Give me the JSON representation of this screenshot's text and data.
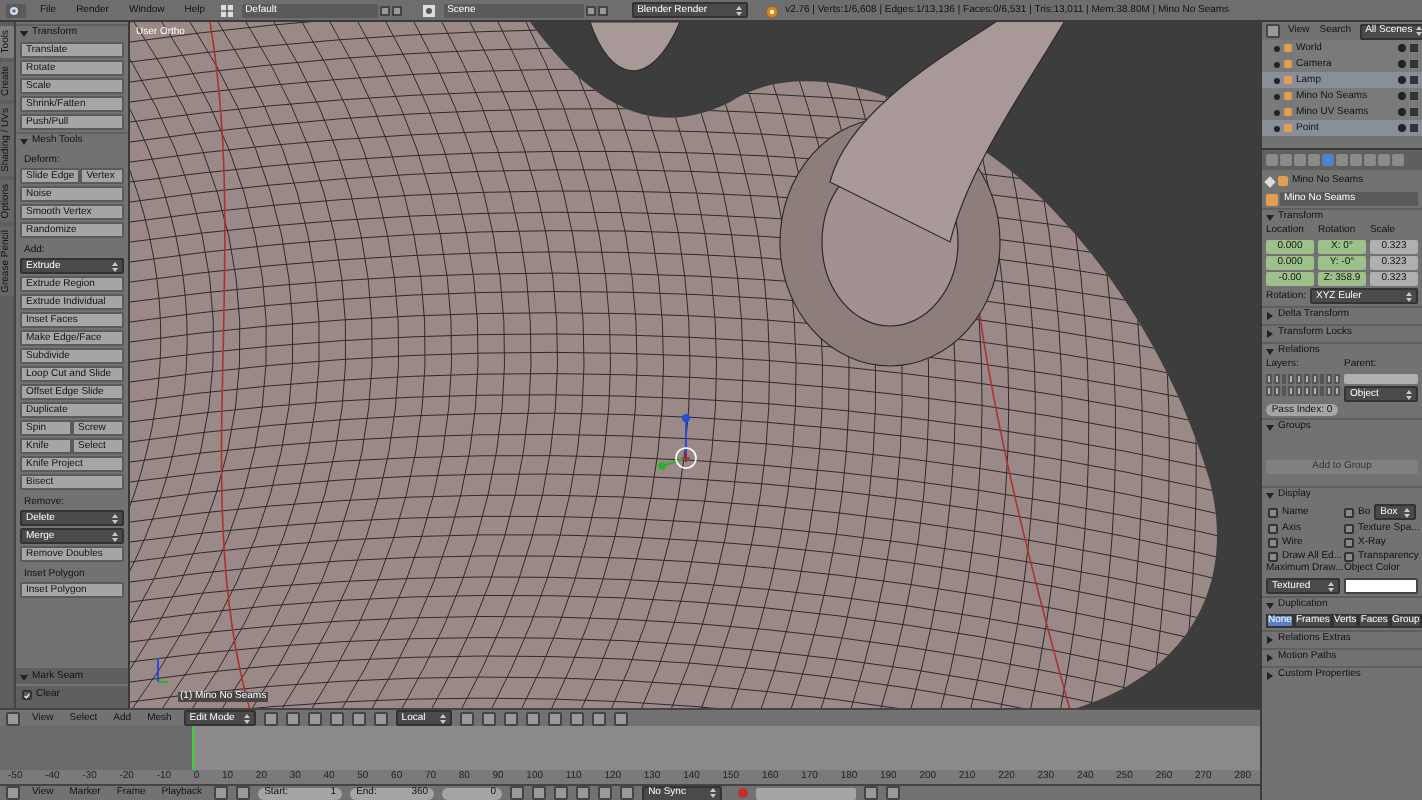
{
  "top_bar": {
    "menus": [
      "File",
      "Render",
      "Window",
      "Help"
    ],
    "layout": "Default",
    "scene": "Scene",
    "engine": "Blender Render",
    "stats": "v2.76 | Verts:1/6,608 | Edges:1/13,136 | Faces:0/6,531 | Tris:13,011 | Mem:38.80M | Mino No Seams"
  },
  "tool_shelf": {
    "tabs": [
      {
        "label": "Tools",
        "selected": true
      },
      {
        "label": "Create",
        "selected": false
      },
      {
        "label": "Shading / UVs",
        "selected": false
      },
      {
        "label": "Options",
        "selected": false
      },
      {
        "label": "Grease Pencil",
        "selected": false
      }
    ],
    "items": [
      {
        "kind": "header",
        "label": "Transform",
        "expanded": true
      },
      {
        "kind": "button",
        "label": "Translate"
      },
      {
        "kind": "button",
        "label": "Rotate"
      },
      {
        "kind": "button",
        "label": "Scale"
      },
      {
        "kind": "button",
        "label": "Shrink/Fatten"
      },
      {
        "kind": "button",
        "label": "Push/Pull"
      },
      {
        "kind": "header",
        "label": "Mesh Tools",
        "expanded": true
      },
      {
        "kind": "label",
        "label": "Deform:"
      },
      {
        "kind": "pair",
        "labels": [
          "Slide Edge",
          "Vertex"
        ]
      },
      {
        "kind": "button",
        "label": "Noise"
      },
      {
        "kind": "button",
        "label": "Smooth Vertex"
      },
      {
        "kind": "button",
        "label": "Randomize"
      },
      {
        "kind": "label",
        "label": "Add:"
      },
      {
        "kind": "dropdown",
        "label": "Extrude"
      },
      {
        "kind": "button",
        "label": "Extrude Region"
      },
      {
        "kind": "button",
        "label": "Extrude Individual"
      },
      {
        "kind": "button",
        "label": "Inset Faces"
      },
      {
        "kind": "button",
        "label": "Make Edge/Face"
      },
      {
        "kind": "button",
        "label": "Subdivide"
      },
      {
        "kind": "button",
        "label": "Loop Cut and Slide"
      },
      {
        "kind": "button",
        "label": "Offset Edge Slide"
      },
      {
        "kind": "button",
        "label": "Duplicate"
      },
      {
        "kind": "pair",
        "labels": [
          "Spin",
          "Screw"
        ]
      },
      {
        "kind": "pair",
        "labels": [
          "Knife",
          "Select"
        ]
      },
      {
        "kind": "button",
        "label": "Knife Project"
      },
      {
        "kind": "button",
        "label": "Bisect"
      },
      {
        "kind": "label",
        "label": "Remove:"
      },
      {
        "kind": "dropdown",
        "label": "Delete"
      },
      {
        "kind": "dropdown",
        "label": "Merge"
      },
      {
        "kind": "button",
        "label": "Remove Doubles"
      },
      {
        "kind": "label",
        "label": "Inset Polygon"
      },
      {
        "kind": "button",
        "label": "Inset Polygon"
      }
    ],
    "operator": {
      "title": "Mark Seam",
      "expanded": true,
      "options": [
        {
          "label": "Clear",
          "checked": true
        }
      ]
    }
  },
  "viewport": {
    "view_label": "User Ortho",
    "object_label": "(1) Mino No Seams"
  },
  "view3d_header": {
    "menus": [
      "View",
      "Select",
      "Add",
      "Mesh"
    ],
    "mode": "Edit Mode",
    "orientation": "Local"
  },
  "timeline": {
    "ruler": [
      "-50",
      "-40",
      "-30",
      "-20",
      "-10",
      "0",
      "10",
      "20",
      "30",
      "40",
      "50",
      "60",
      "70",
      "80",
      "90",
      "100",
      "110",
      "120",
      "130",
      "140",
      "150",
      "160",
      "170",
      "180",
      "190",
      "200",
      "210",
      "220",
      "230",
      "240",
      "250",
      "260",
      "270",
      "280"
    ],
    "playhead": {
      "level": 0.152
    }
  },
  "timeline_header": {
    "menus": [
      "View",
      "Marker",
      "Frame",
      "Playback"
    ],
    "start_label": "Start:",
    "start": "1",
    "end_label": "End:",
    "end": "360",
    "current": "0",
    "sync": "No Sync"
  },
  "outliner": {
    "menus": [
      "View",
      "Search"
    ],
    "filter": "All Scenes",
    "rows": [
      {
        "name": "World",
        "selected": false
      },
      {
        "name": "Camera",
        "selected": false
      },
      {
        "name": "Lamp",
        "selected": true
      },
      {
        "name": "Mino No Seams",
        "selected": false
      },
      {
        "name": "Mino UV Seams",
        "selected": false
      },
      {
        "name": "Point",
        "selected": true
      }
    ]
  },
  "properties": {
    "breadcrumb": "Mino No Seams",
    "object_name": "Mino No Seams",
    "transform": {
      "title": "Transform",
      "expanded": true,
      "columns": [
        {
          "heading": "Location",
          "values": [
            "0.000",
            "0.000",
            "-0.00"
          ]
        },
        {
          "heading": "Rotation",
          "values": [
            "X: 0°",
            "Y: -0°",
            "Z: 358.9"
          ]
        },
        {
          "heading": "Scale",
          "values": [
            "0.323",
            "0.323",
            "0.323"
          ]
        }
      ],
      "mode_label": "Rotation:",
      "mode": "XYZ Euler"
    },
    "collapsed_top": [
      {
        "title": "Delta Transform",
        "expanded": false
      },
      {
        "title": "Transform Locks",
        "expanded": false
      }
    ],
    "relations": {
      "title": "Relations",
      "expanded": true,
      "layers_label": "Layers:",
      "parent_label": "Parent:",
      "parent_type": "Object",
      "pass_index": "Pass Index: 0"
    },
    "groups": {
      "title": "Groups",
      "expanded": true,
      "button": "Add to Group"
    },
    "display": {
      "title": "Display",
      "expanded": true,
      "checks": [
        {
          "label": "Name",
          "checked": false
        },
        {
          "label": "Bo",
          "checked": false
        },
        {
          "label": "Axis",
          "checked": false
        },
        {
          "label": "Texture Spa...",
          "checked": false
        },
        {
          "label": "Wire",
          "checked": false
        },
        {
          "label": "X-Ray",
          "checked": false
        },
        {
          "label": "Draw All Ed...",
          "checked": false
        },
        {
          "label": "Transparency",
          "checked": false
        }
      ],
      "bounds_type": "Box",
      "max_draw_label": "Maximum Draw...",
      "max_draw": "Textured",
      "color_label": "Object Color"
    },
    "duplication": {
      "title": "Duplication",
      "expanded": true,
      "options": [
        {
          "label": "None",
          "selected": true
        },
        {
          "label": "Frames",
          "selected": false
        },
        {
          "label": "Verts",
          "selected": false
        },
        {
          "label": "Faces",
          "selected": false
        },
        {
          "label": "Group",
          "selected": false
        }
      ]
    },
    "collapsed_bottom": [
      {
        "title": "Relations Extras",
        "expanded": false
      },
      {
        "title": "Motion Paths",
        "expanded": false
      },
      {
        "title": "Custom Properties",
        "expanded": false
      }
    ]
  }
}
